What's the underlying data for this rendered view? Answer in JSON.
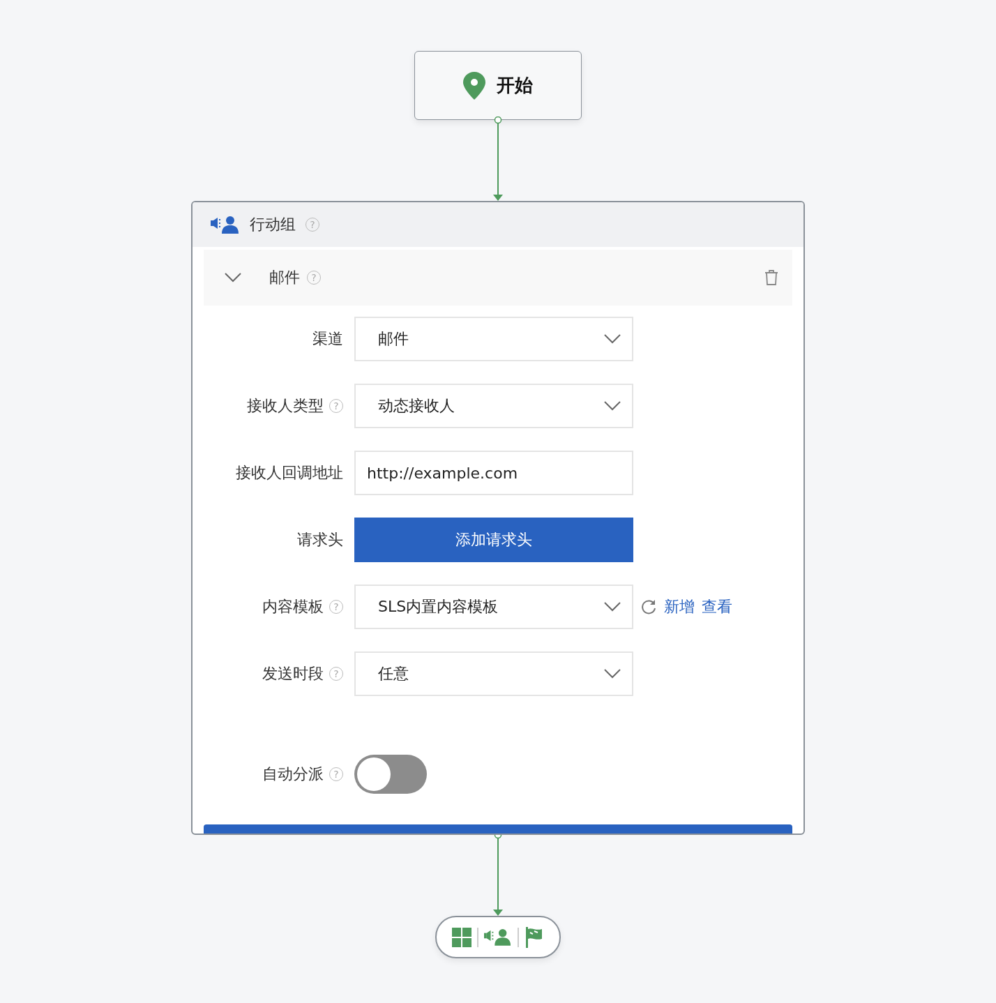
{
  "start_node": {
    "label": "开始"
  },
  "action_group": {
    "title": "行动组",
    "help": "?",
    "action": {
      "title": "邮件",
      "help": "?",
      "expanded": true,
      "fields": [
        {
          "kind": "select",
          "label": "渠道",
          "value": "邮件"
        },
        {
          "kind": "select",
          "label": "接收人类型",
          "help": "?",
          "value": "动态接收人"
        },
        {
          "kind": "input",
          "label": "接收人回调地址",
          "value": "http://example.com"
        },
        {
          "kind": "button",
          "label": "请求头",
          "button": "添加请求头"
        },
        {
          "kind": "select",
          "label": "内容模板",
          "help": "?",
          "value": "SLS内置内容模板",
          "links": [
            "新增",
            "查看"
          ]
        },
        {
          "kind": "select",
          "label": "发送时段",
          "help": "?",
          "value": "任意"
        },
        {
          "kind": "switch",
          "label": "自动分派",
          "help": "?",
          "on": false
        }
      ]
    }
  }
}
